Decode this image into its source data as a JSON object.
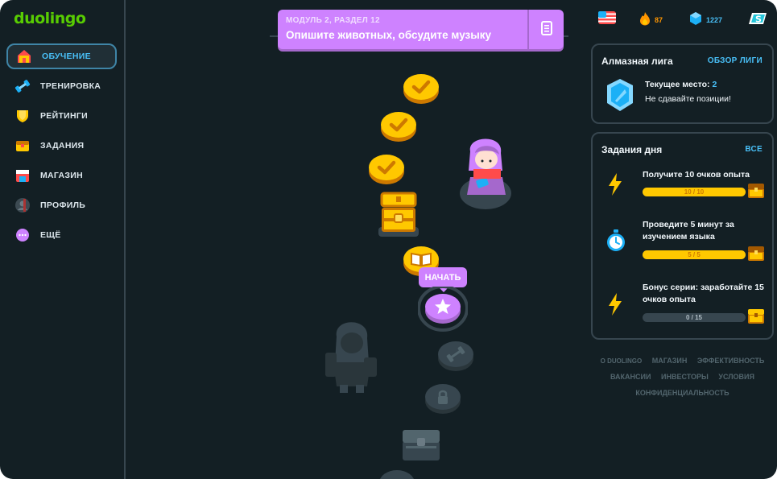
{
  "app": {
    "logo": "duolingo"
  },
  "sidebar": {
    "items": [
      {
        "label": "ОБУЧЕНИЕ",
        "icon": "home-icon",
        "active": true
      },
      {
        "label": "ТРЕНИРОВКА",
        "icon": "dumbbell-icon",
        "active": false
      },
      {
        "label": "РЕЙТИНГИ",
        "icon": "shield-icon",
        "active": false
      },
      {
        "label": "ЗАДАНИЯ",
        "icon": "treasure-chest-icon",
        "active": false
      },
      {
        "label": "МАГАЗИН",
        "icon": "shop-icon",
        "active": false
      },
      {
        "label": "ПРОФИЛЬ",
        "icon": "avatar-icon",
        "active": false
      },
      {
        "label": "ЕЩЁ",
        "icon": "more-icon",
        "active": false
      }
    ]
  },
  "unit": {
    "subtitle": "МОДУЛЬ 2, РАЗДЕЛ 12",
    "title": "Опишите животных, обсудите музыку",
    "guide_icon": "notebook-icon"
  },
  "path": {
    "start_label": "НАЧАТЬ",
    "nodes": [
      {
        "type": "completed",
        "icon": "check-icon"
      },
      {
        "type": "completed",
        "icon": "check-icon"
      },
      {
        "type": "completed",
        "icon": "check-icon"
      },
      {
        "type": "chest-open",
        "icon": "treasure-chest-icon"
      },
      {
        "type": "story",
        "icon": "book-icon"
      },
      {
        "type": "current",
        "icon": "star-icon"
      },
      {
        "type": "locked",
        "icon": "dumbbell-icon"
      },
      {
        "type": "locked",
        "icon": "lock-icon"
      },
      {
        "type": "locked-chest",
        "icon": "treasure-chest-icon"
      }
    ]
  },
  "stats": {
    "language": {
      "icon": "us-flag-icon"
    },
    "streak": {
      "icon": "fire-icon",
      "value": "87"
    },
    "gems": {
      "icon": "gem-icon",
      "value": "1227"
    },
    "super": {
      "icon": "super-icon"
    }
  },
  "league": {
    "title": "Алмазная лига",
    "link": "ОБЗОР ЛИГИ",
    "place_label": "Текущее место:",
    "place_value": "2",
    "message": "Не сдавайте позиции!",
    "icon": "diamond-league-icon"
  },
  "quests": {
    "title": "Задания дня",
    "link": "ВСЕ",
    "items": [
      {
        "text": "Получите 10 очков опыта",
        "progress_label": "10 / 10",
        "progress": 1.0,
        "icon": "lightning-icon"
      },
      {
        "text": "Проведите 5 минут за изучением языка",
        "progress_label": "5 / 5",
        "progress": 1.0,
        "icon": "timer-icon"
      },
      {
        "text": "Бонус серии: заработайте 15 очков опыта",
        "progress_label": "0 / 15",
        "progress": 0.0,
        "icon": "lightning-icon"
      }
    ]
  },
  "footer": {
    "links": [
      "О DUOLINGO",
      "МАГАЗИН",
      "ЭФФЕКТИВНОСТЬ",
      "ВАКАНСИИ",
      "ИНВЕСТОРЫ",
      "УСЛОВИЯ",
      "КОНФИДЕНЦИАЛЬНОСТЬ"
    ]
  },
  "colors": {
    "background": "#131f24",
    "accent_blue": "#49c0f8",
    "brand_green": "#58cc02",
    "unit_purple": "#ce82ff",
    "gold": "#ffc800",
    "streak_orange": "#ff9600"
  }
}
